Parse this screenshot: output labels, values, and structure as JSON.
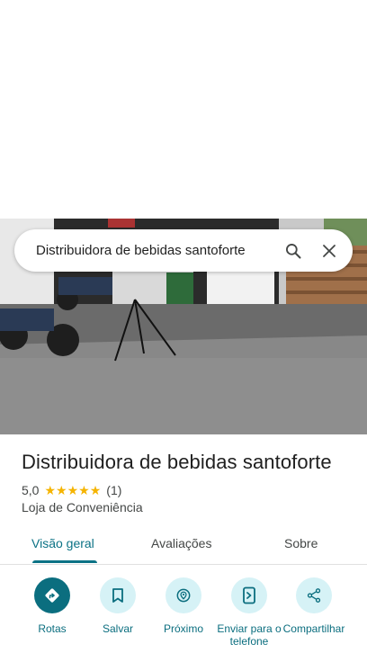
{
  "search": {
    "query": "Distribuidora de bebidas santoforte"
  },
  "place": {
    "title": "Distribuidora de bebidas santoforte",
    "rating": "5,0",
    "stars": 5,
    "review_count": "(1)",
    "category": "Loja de Conveniência"
  },
  "tabs": [
    {
      "label": "Visão geral",
      "active": true
    },
    {
      "label": "Avaliações",
      "active": false
    },
    {
      "label": "Sobre",
      "active": false
    }
  ],
  "actions": [
    {
      "label": "Rotas",
      "icon": "directions-icon"
    },
    {
      "label": "Salvar",
      "icon": "bookmark-icon"
    },
    {
      "label": "Próximo",
      "icon": "nearby-icon"
    },
    {
      "label": "Enviar para o telefone",
      "icon": "send-to-phone-icon"
    },
    {
      "label": "Compartilhar",
      "icon": "share-icon"
    }
  ],
  "colors": {
    "accent": "#0b6e7f",
    "star": "#f5b400",
    "action_bg": "#d6f2f6"
  }
}
